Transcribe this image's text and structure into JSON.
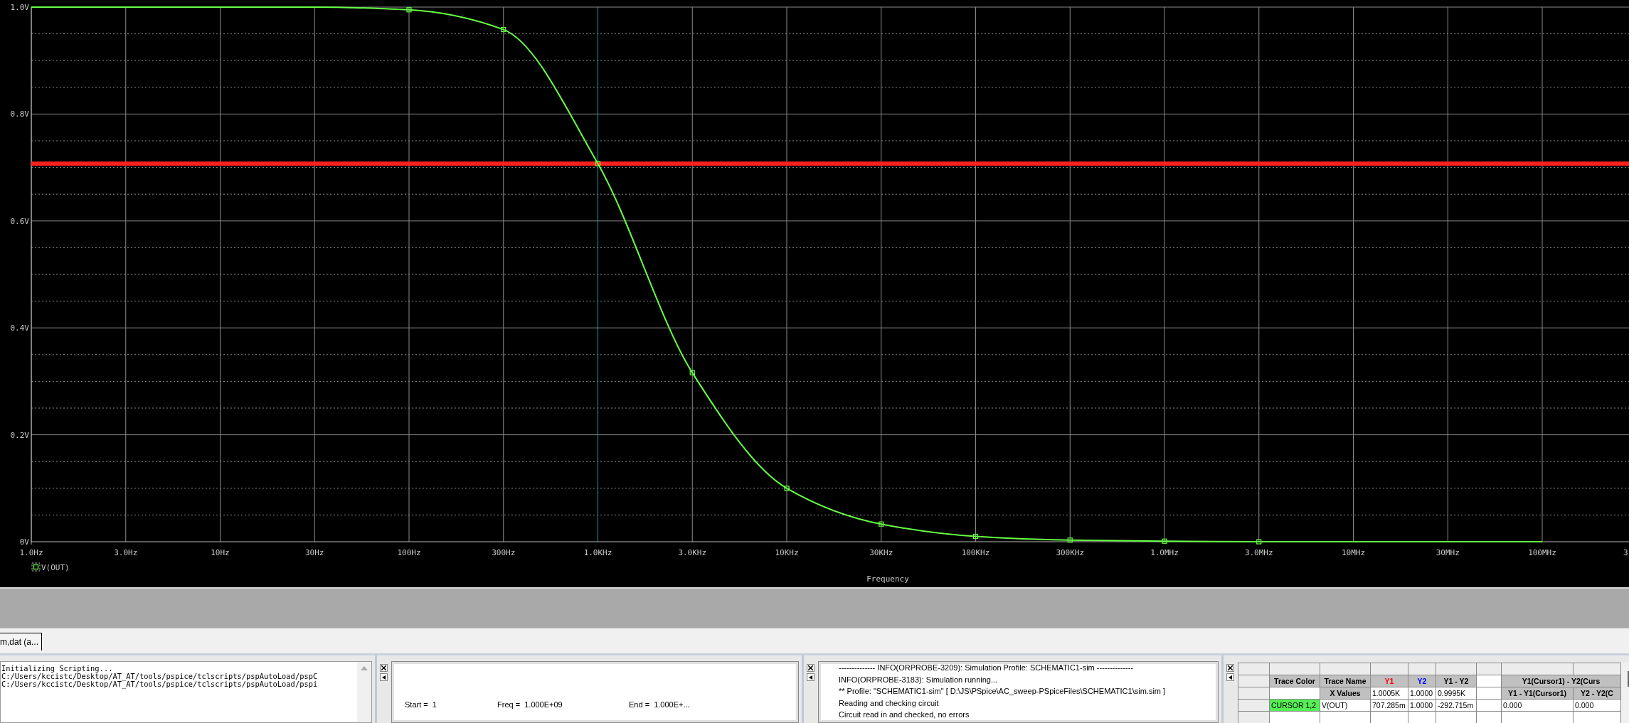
{
  "plot": {
    "chart_data": {
      "type": "line",
      "xlabel": "Frequency",
      "categories": [
        "1.0Hz",
        "3.0Hz",
        "10Hz",
        "30Hz",
        "100Hz",
        "300Hz",
        "1.0KHz",
        "3.0KHz",
        "10KHz",
        "30KHz",
        "100KHz",
        "300KHz",
        "1.0MHz",
        "3.0MHz",
        "10MHz",
        "30MHz",
        "100MHz",
        "3"
      ],
      "series": [
        {
          "name": "V(OUT)",
          "color": "#66ff44",
          "values": [
            1.0,
            1.0,
            1.0,
            1.0,
            0.995,
            0.958,
            0.707,
            0.316,
            0.1,
            0.033,
            0.01,
            0.003,
            0.001,
            0.0,
            0.0,
            0.0,
            0.0,
            null
          ]
        }
      ],
      "ylim": [
        0,
        1
      ],
      "yticks": [
        {
          "value": 0,
          "label": "0V"
        },
        {
          "value": 0.2,
          "label": "0.2V"
        },
        {
          "value": 0.4,
          "label": "0.4V"
        },
        {
          "value": 0.6,
          "label": "0.6V"
        },
        {
          "value": 0.8,
          "label": "0.8V"
        },
        {
          "value": 1.0,
          "label": "1.0V"
        }
      ],
      "grid": true,
      "ref_lines": [
        {
          "axis": "x",
          "value": "1.0KHz",
          "color": "#1aa0a0"
        },
        {
          "axis": "y",
          "value": 0.707,
          "color": "#ff2020"
        }
      ]
    }
  },
  "tab_bar": {
    "tabs": [
      {
        "label": "m,dat (a...",
        "selected": true
      }
    ]
  },
  "console": {
    "lines": [
      "Initializing Scripting...",
      "C:/Users/kccistc/Desktop/AT_AT/tools/pspice/tclscripts/pspAutoLoad/pspC",
      "C:/Users/kccistc/Desktop/AT_AT/tools/pspice/tclscripts/pspAutoLoad/pspi"
    ]
  },
  "sweep_pane": {
    "fields": [
      "Start =  1",
      "Freq =  1.000E+09",
      "End =  1.000E+..."
    ]
  },
  "output_pane": {
    "lines": [
      "-------------- INFO(ORPROBE-3209): Simulation Profile:  SCHEMATIC1-sim --------------",
      "INFO(ORPROBE-3183): Simulation running...",
      "** Profile: \"SCHEMATIC1-sim\"  [ D:\\JS\\PSpice\\AC_sweep-PSpiceFiles\\SCHEMATIC1\\sim.sim ]",
      "Reading and checking circuit",
      "Circuit read in and checked, no errors"
    ]
  },
  "cursor_table": {
    "rows": [
      [
        {
          "kind": "stub"
        },
        {
          "kind": "stub"
        },
        {
          "kind": "stub"
        },
        {
          "kind": "stub"
        },
        {
          "kind": "stub"
        },
        {
          "kind": "stub"
        },
        {
          "kind": "stub"
        },
        {
          "kind": "stub"
        },
        {
          "kind": "stub"
        }
      ],
      [
        {
          "kind": "stub"
        },
        {
          "kind": "head",
          "text": "Trace Color"
        },
        {
          "kind": "head",
          "text": "Trace Name"
        },
        {
          "kind": "head",
          "text": "Y1",
          "color": "#ff0000"
        },
        {
          "kind": "head",
          "text": "Y2",
          "color": "#0000ff"
        },
        {
          "kind": "head",
          "text": "Y1 - Y2"
        },
        {
          "kind": "blank"
        },
        {
          "kind": "head",
          "text": "Y1(Cursor1) - Y2(Curs"
        }
      ],
      [
        {
          "kind": "stub"
        },
        {
          "kind": "blank"
        },
        {
          "kind": "head",
          "text": "X Values"
        },
        {
          "kind": "cell",
          "text": "1.0005K"
        },
        {
          "kind": "cell",
          "text": "1.0000"
        },
        {
          "kind": "cell",
          "text": "0.9995K"
        },
        {
          "kind": "blank"
        },
        {
          "kind": "head",
          "text": "Y1 - Y1(Cursor1)"
        },
        {
          "kind": "head",
          "text": "Y2 - Y2(C"
        }
      ],
      [
        {
          "kind": "stub"
        },
        {
          "kind": "swatch",
          "text": "CURSOR 1,2",
          "color": "#55ee55"
        },
        {
          "kind": "cell",
          "text": "V(OUT)"
        },
        {
          "kind": "cell",
          "text": "707.285m"
        },
        {
          "kind": "cell",
          "text": "1.0000"
        },
        {
          "kind": "cell",
          "text": "-292.715m"
        },
        {
          "kind": "blank"
        },
        {
          "kind": "cell",
          "text": "0.000"
        },
        {
          "kind": "cell",
          "text": "0.000"
        }
      ],
      [
        {
          "kind": "stub"
        },
        {
          "kind": "blank"
        },
        {
          "kind": "blank"
        },
        {
          "kind": "blank"
        },
        {
          "kind": "blank"
        },
        {
          "kind": "blank"
        },
        {
          "kind": "blank"
        },
        {
          "kind": "blank"
        },
        {
          "kind": "blank"
        }
      ]
    ]
  }
}
